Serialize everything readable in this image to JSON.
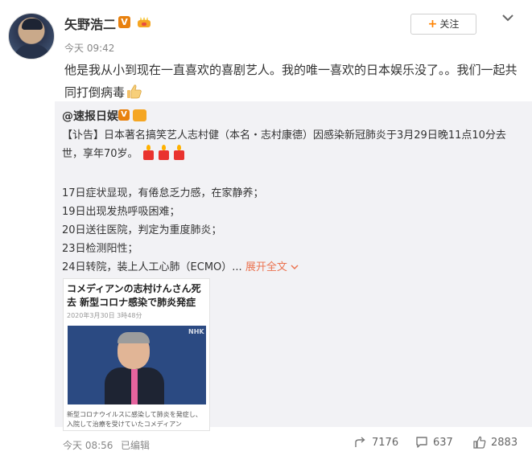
{
  "post": {
    "author": "矢野浩二",
    "verified_label": "V",
    "time": "今天 09:42",
    "text": "他是我从小到现在一直喜欢的喜剧艺人。我的唯一喜欢的日本娱乐没了。。我们一起共同打倒病毒",
    "follow_label": "关注"
  },
  "repost": {
    "author": "@速报日娱",
    "verified_label": "V",
    "body": "【讣告】日本著名搞笑艺人志村健（本名・志村康德）因感染新冠肺炎于3月29日晚11点10分去世，享年70岁。",
    "timeline": [
      "17日症状显现，有倦怠乏力感，在家静养；",
      "19日出现发热呼吸困难；",
      "20日送往医院，判定为重度肺炎；",
      "23日检测阳性；",
      "24日转院，装上人工心肺（ECMO）..."
    ],
    "expand_label": "展开全文",
    "news_image": {
      "headline": "コメディアンの志村けんさん死去 新型コロナ感染で肺炎発症",
      "date": "2020年3月30日 3時48分",
      "watermark": "NHK",
      "caption": "新型コロナウイルスに感染して肺炎を発症し、入院して治療を受けていたコメディアン"
    }
  },
  "footer": {
    "time": "今天 08:56",
    "edited": "已编辑",
    "forward_count": "7176",
    "comment_count": "637",
    "like_count": "2883"
  },
  "colors": {
    "accent": "#ff8200",
    "link": "#eb7350",
    "verified": "#e8810e",
    "repost_bg": "#f2f2f5"
  }
}
